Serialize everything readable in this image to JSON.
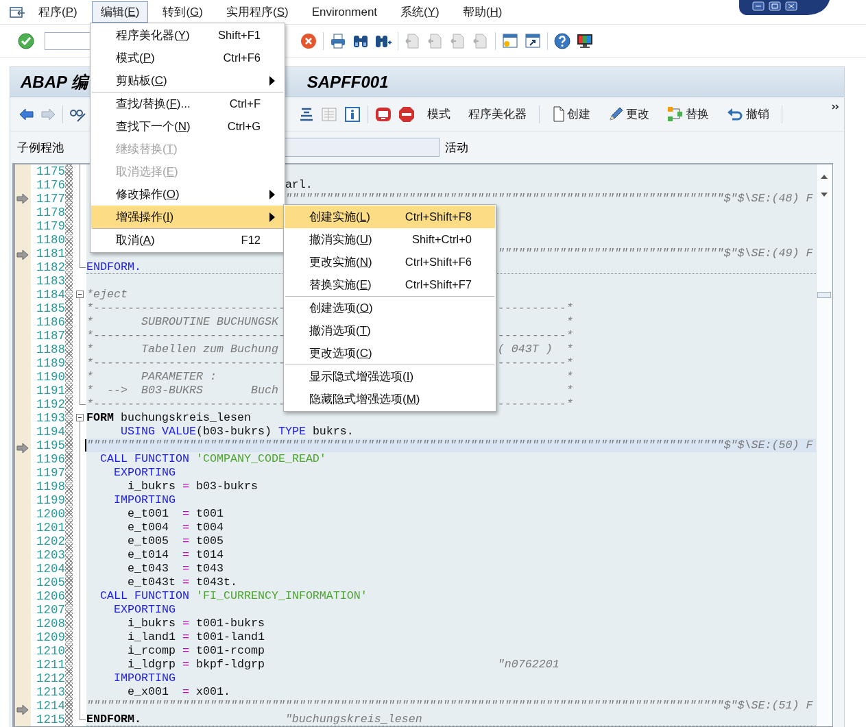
{
  "menubar": {
    "items": [
      {
        "label": "程序(P)",
        "selected": false
      },
      {
        "label": "编辑(E)",
        "selected": true
      },
      {
        "label": "转到(G)",
        "selected": false
      },
      {
        "label": "实用程序(S)",
        "selected": false
      },
      {
        "label": "Environment",
        "selected": false
      },
      {
        "label": "系统(Y)",
        "selected": false
      },
      {
        "label": "帮助(H)",
        "selected": false
      }
    ]
  },
  "title": {
    "left": "ABAP 编",
    "right": "SAPFF001"
  },
  "app_toolbar": {
    "buttons": [
      {
        "label": "模式"
      },
      {
        "label": "程序美化器"
      },
      {
        "label": "创建"
      },
      {
        "label": "更改"
      },
      {
        "label": "替换"
      },
      {
        "label": "撤销"
      }
    ]
  },
  "program_row": {
    "label": "子例程池",
    "status": "活动"
  },
  "editor": {
    "lines": [
      {
        "no": "1175",
        "kind": "fold-body",
        "marker": false,
        "current": false,
        "separator": false
      },
      {
        "no": "1176",
        "kind": "fold-body",
        "marker": false,
        "current": false,
        "separator": false,
        "segments": [
          {
            "kind": "text",
            "text": "                             arl."
          }
        ]
      },
      {
        "no": "1177",
        "kind": "fold-body",
        "marker": true,
        "current": false,
        "separator": false,
        "segments": [
          {
            "kind": "marker",
            "text": "                             \"\"\"\"\"\"\"\"\"\"\"\"\"\"\"\"\"\"\"\"\"\"\"\"\"\"\"\"\"\"\"\"\"\"\"\"\"\"\"\"\"\"\"\"\"\"\"\"\"\"\"\"\"\"\"\"\"\"\"\"\"\"\"\"$\"$\\SE:(48) F"
          }
        ]
      },
      {
        "no": "1178",
        "kind": "fold-body",
        "marker": false,
        "current": false,
        "separator": false
      },
      {
        "no": "1179",
        "kind": "fold-body",
        "marker": false,
        "current": false,
        "separator": false
      },
      {
        "no": "1180",
        "kind": "fold-body",
        "marker": false,
        "current": false,
        "separator": false
      },
      {
        "no": "1181",
        "kind": "fold-body",
        "marker": true,
        "current": false,
        "separator": false,
        "segments": [
          {
            "kind": "marker",
            "text": "                                                            \"\"\"\"\"\"\"\"\"\"\"\"\"\"\"\"\"\"\"\"\"\"\"\"\"\"\"\"\"\"\"\"\"$\"$\\SE:(49) F"
          }
        ]
      },
      {
        "no": "1182",
        "kind": "fold-end",
        "marker": false,
        "current": false,
        "separator": true,
        "segments": [
          {
            "kind": "keyword",
            "text": "ENDFORM."
          }
        ]
      },
      {
        "no": "1183",
        "kind": "plain",
        "marker": false,
        "current": false,
        "separator": false
      },
      {
        "no": "1184",
        "kind": "fold-start",
        "marker": false,
        "current": false,
        "separator": false,
        "segments": [
          {
            "kind": "comment",
            "text": "*eject"
          }
        ]
      },
      {
        "no": "1185",
        "kind": "fold-body",
        "marker": false,
        "current": false,
        "separator": false,
        "segments": [
          {
            "kind": "comment",
            "text": "*----------------------------"
          },
          {
            "kind": "comment",
            "text": "                               ----------*"
          }
        ]
      },
      {
        "no": "1186",
        "kind": "fold-body",
        "marker": false,
        "current": false,
        "separator": false,
        "segments": [
          {
            "kind": "comment",
            "text": "*       SUBROUTINE BUCHUNGSK"
          },
          {
            "kind": "comment",
            "text": "                                          *"
          }
        ]
      },
      {
        "no": "1187",
        "kind": "fold-body",
        "marker": false,
        "current": false,
        "separator": false,
        "segments": [
          {
            "kind": "comment",
            "text": "*----------------------------"
          },
          {
            "kind": "comment",
            "text": "                               ----------*"
          }
        ]
      },
      {
        "no": "1188",
        "kind": "fold-body",
        "marker": false,
        "current": false,
        "separator": false,
        "segments": [
          {
            "kind": "comment",
            "text": "*       Tabellen zum Buchung"
          },
          {
            "kind": "comment",
            "text": "                                ( 043T )  *"
          }
        ]
      },
      {
        "no": "1189",
        "kind": "fold-body",
        "marker": false,
        "current": false,
        "separator": false,
        "segments": [
          {
            "kind": "comment",
            "text": "*----------------------------"
          },
          {
            "kind": "comment",
            "text": "                               ----------*"
          }
        ]
      },
      {
        "no": "1190",
        "kind": "fold-body",
        "marker": false,
        "current": false,
        "separator": false,
        "segments": [
          {
            "kind": "comment",
            "text": "*       PARAMETER :"
          },
          {
            "kind": "comment",
            "text": "                                                   *"
          }
        ]
      },
      {
        "no": "1191",
        "kind": "fold-body",
        "marker": false,
        "current": false,
        "separator": false,
        "segments": [
          {
            "kind": "comment",
            "text": "*  -->  B03-BUKRS       Buch"
          },
          {
            "kind": "comment",
            "text": "                                          *"
          }
        ]
      },
      {
        "no": "1192",
        "kind": "fold-end",
        "marker": false,
        "current": false,
        "separator": false,
        "segments": [
          {
            "kind": "comment",
            "text": "*----------------------------"
          },
          {
            "kind": "comment",
            "text": "                               ----------*"
          }
        ]
      },
      {
        "no": "1193",
        "kind": "fold-start",
        "marker": false,
        "current": false,
        "separator": false,
        "segments": [
          {
            "kind": "bold",
            "text": "FORM"
          },
          {
            "kind": "text",
            "text": " buchungskreis_lesen"
          }
        ]
      },
      {
        "no": "1194",
        "kind": "fold-body",
        "marker": false,
        "current": false,
        "separator": false,
        "segments": [
          {
            "kind": "keyword",
            "text": "     USING VALUE"
          },
          {
            "kind": "text",
            "text": "(b03-bukrs) "
          },
          {
            "kind": "keyword",
            "text": "TYPE"
          },
          {
            "kind": "text",
            "text": " bukrs."
          }
        ]
      },
      {
        "no": "1195",
        "kind": "fold-body",
        "marker": true,
        "current": true,
        "separator": false,
        "segments": [
          {
            "kind": "marker",
            "text": "\"\"\"\"\"\"\"\"\"\"\"\"\"\"\"\"\"\"\"\"\"\"\"\"\"\"\"\"\"\"\"\"\"\"\"\"\"\"\"\"\"\"\"\"\"\"\"\"\"\"\"\"\"\"\"\"\"\"\"\"\"\"\"\"\"\"\"\"\"\"\"\"\"\"\"\"\"\"\"\"\"\"\"\"\"\"\"\"\"\"\"\"\"$\"$\\SE:(50) F"
          }
        ]
      },
      {
        "no": "1196",
        "kind": "fold-body",
        "marker": false,
        "current": false,
        "separator": false,
        "segments": [
          {
            "kind": "keyword",
            "text": "  CALL FUNCTION"
          },
          {
            "kind": "string",
            "text": " 'COMPANY_CODE_READ'"
          }
        ]
      },
      {
        "no": "1197",
        "kind": "fold-body",
        "marker": false,
        "current": false,
        "separator": false,
        "segments": [
          {
            "kind": "keyword",
            "text": "    EXPORTING"
          }
        ]
      },
      {
        "no": "1198",
        "kind": "fold-body",
        "marker": false,
        "current": false,
        "separator": false,
        "segments": [
          {
            "kind": "text",
            "text": "      i_bukrs "
          },
          {
            "kind": "operator",
            "text": "="
          },
          {
            "kind": "text",
            "text": " b03-bukrs"
          }
        ]
      },
      {
        "no": "1199",
        "kind": "fold-body",
        "marker": false,
        "current": false,
        "separator": false,
        "segments": [
          {
            "kind": "keyword",
            "text": "    IMPORTING"
          }
        ]
      },
      {
        "no": "1200",
        "kind": "fold-body",
        "marker": false,
        "current": false,
        "separator": false,
        "segments": [
          {
            "kind": "text",
            "text": "      e_t001  "
          },
          {
            "kind": "operator",
            "text": "="
          },
          {
            "kind": "text",
            "text": " t001"
          }
        ]
      },
      {
        "no": "1201",
        "kind": "fold-body",
        "marker": false,
        "current": false,
        "separator": false,
        "segments": [
          {
            "kind": "text",
            "text": "      e_t004  "
          },
          {
            "kind": "operator",
            "text": "="
          },
          {
            "kind": "text",
            "text": " t004"
          }
        ]
      },
      {
        "no": "1202",
        "kind": "fold-body",
        "marker": false,
        "current": false,
        "separator": false,
        "segments": [
          {
            "kind": "text",
            "text": "      e_t005  "
          },
          {
            "kind": "operator",
            "text": "="
          },
          {
            "kind": "text",
            "text": " t005"
          }
        ]
      },
      {
        "no": "1203",
        "kind": "fold-body",
        "marker": false,
        "current": false,
        "separator": false,
        "segments": [
          {
            "kind": "text",
            "text": "      e_t014  "
          },
          {
            "kind": "operator",
            "text": "="
          },
          {
            "kind": "text",
            "text": " t014"
          }
        ]
      },
      {
        "no": "1204",
        "kind": "fold-body",
        "marker": false,
        "current": false,
        "separator": false,
        "segments": [
          {
            "kind": "text",
            "text": "      e_t043  "
          },
          {
            "kind": "operator",
            "text": "="
          },
          {
            "kind": "text",
            "text": " t043"
          }
        ]
      },
      {
        "no": "1205",
        "kind": "fold-body",
        "marker": false,
        "current": false,
        "separator": false,
        "segments": [
          {
            "kind": "text",
            "text": "      e_t043t "
          },
          {
            "kind": "operator",
            "text": "="
          },
          {
            "kind": "text",
            "text": " t043t."
          }
        ]
      },
      {
        "no": "1206",
        "kind": "fold-body",
        "marker": false,
        "current": false,
        "separator": false,
        "segments": [
          {
            "kind": "keyword",
            "text": "  CALL FUNCTION"
          },
          {
            "kind": "string",
            "text": " 'FI_CURRENCY_INFORMATION'"
          }
        ]
      },
      {
        "no": "1207",
        "kind": "fold-body",
        "marker": false,
        "current": false,
        "separator": false,
        "segments": [
          {
            "kind": "keyword",
            "text": "    EXPORTING"
          }
        ]
      },
      {
        "no": "1208",
        "kind": "fold-body",
        "marker": false,
        "current": false,
        "separator": false,
        "segments": [
          {
            "kind": "text",
            "text": "      i_bukrs "
          },
          {
            "kind": "operator",
            "text": "="
          },
          {
            "kind": "text",
            "text": " t001-bukrs"
          }
        ]
      },
      {
        "no": "1209",
        "kind": "fold-body",
        "marker": false,
        "current": false,
        "separator": false,
        "segments": [
          {
            "kind": "text",
            "text": "      i_land1 "
          },
          {
            "kind": "operator",
            "text": "="
          },
          {
            "kind": "text",
            "text": " t001-land1"
          }
        ]
      },
      {
        "no": "1210",
        "kind": "fold-body",
        "marker": false,
        "current": false,
        "separator": false,
        "segments": [
          {
            "kind": "text",
            "text": "      i_rcomp "
          },
          {
            "kind": "operator",
            "text": "="
          },
          {
            "kind": "text",
            "text": " t001-rcomp"
          }
        ]
      },
      {
        "no": "1211",
        "kind": "fold-body",
        "marker": false,
        "current": false,
        "separator": false,
        "segments": [
          {
            "kind": "text",
            "text": "      i_ldgrp "
          },
          {
            "kind": "operator",
            "text": "="
          },
          {
            "kind": "text",
            "text": " bkpf-ldgrp"
          },
          {
            "kind": "comment",
            "text": "                                  \"n0762201"
          }
        ]
      },
      {
        "no": "1212",
        "kind": "fold-body",
        "marker": false,
        "current": false,
        "separator": false,
        "segments": [
          {
            "kind": "keyword",
            "text": "    IMPORTING"
          }
        ]
      },
      {
        "no": "1213",
        "kind": "fold-body",
        "marker": false,
        "current": false,
        "separator": false,
        "segments": [
          {
            "kind": "text",
            "text": "      e_x001  "
          },
          {
            "kind": "operator",
            "text": "="
          },
          {
            "kind": "text",
            "text": " x001."
          }
        ]
      },
      {
        "no": "1214",
        "kind": "fold-body",
        "marker": true,
        "current": false,
        "separator": false,
        "segments": [
          {
            "kind": "marker",
            "text": "\"\"\"\"\"\"\"\"\"\"\"\"\"\"\"\"\"\"\"\"\"\"\"\"\"\"\"\"\"\"\"\"\"\"\"\"\"\"\"\"\"\"\"\"\"\"\"\"\"\"\"\"\"\"\"\"\"\"\"\"\"\"\"\"\"\"\"\"\"\"\"\"\"\"\"\"\"\"\"\"\"\"\"\"\"\"\"\"\"\"\"\"\"$\"$\\SE:(51) F"
          }
        ]
      },
      {
        "no": "1215",
        "kind": "fold-end",
        "marker": false,
        "current": false,
        "separator": true,
        "segments": [
          {
            "kind": "bold",
            "text": "ENDFORM."
          },
          {
            "kind": "comment",
            "text": "                     \"buchungskreis_lesen"
          }
        ]
      }
    ]
  },
  "menus": [
    {
      "kind": "dropdown",
      "groups": [
        [
          {
            "kind": "command",
            "label": "程序美化器(Y)",
            "shortcut": "Shift+F1",
            "disabled": false,
            "selected": false
          },
          {
            "kind": "command",
            "label": "模式(P)",
            "shortcut": "Ctrl+F6",
            "disabled": false,
            "selected": false
          },
          {
            "kind": "submenu",
            "label": "剪贴板(C)",
            "disabled": false,
            "selected": false
          }
        ],
        [
          {
            "kind": "command",
            "label": "查找/替换(F)...",
            "shortcut": "Ctrl+F",
            "disabled": false,
            "selected": false
          },
          {
            "kind": "command",
            "label": "查找下一个(N)",
            "shortcut": "Ctrl+G",
            "disabled": false,
            "selected": false
          },
          {
            "kind": "command",
            "label": "继续替换(T)",
            "disabled": true,
            "selected": false
          },
          {
            "kind": "command",
            "label": "取消选择(E)",
            "disabled": true,
            "selected": false
          },
          {
            "kind": "submenu",
            "label": "修改操作(O)",
            "disabled": false,
            "selected": false
          },
          {
            "kind": "submenu",
            "label": "增强操作(I)",
            "disabled": false,
            "selected": true
          }
        ],
        [
          {
            "kind": "command",
            "label": "取消(A)",
            "shortcut": "F12",
            "disabled": false,
            "selected": false
          }
        ]
      ]
    },
    {
      "kind": "submenu",
      "groups": [
        [
          {
            "kind": "command",
            "label": "创建实施(L)",
            "shortcut": "Ctrl+Shift+F8",
            "disabled": false,
            "selected": true
          },
          {
            "kind": "command",
            "label": "撤消实施(U)",
            "shortcut": "Shift+Ctrl+0",
            "disabled": false,
            "selected": false
          },
          {
            "kind": "command",
            "label": "更改实施(N)",
            "shortcut": "Ctrl+Shift+F6",
            "disabled": false,
            "selected": false
          },
          {
            "kind": "command",
            "label": "替换实施(E)",
            "shortcut": "Ctrl+Shift+F7",
            "disabled": false,
            "selected": false
          }
        ],
        [
          {
            "kind": "command",
            "label": "创建选项(O)",
            "disabled": false,
            "selected": false
          },
          {
            "kind": "command",
            "label": "撤消选项(T)",
            "disabled": false,
            "selected": false
          },
          {
            "kind": "command",
            "label": "更改选项(C)",
            "disabled": false,
            "selected": false
          }
        ],
        [
          {
            "kind": "command",
            "label": "显示隐式增强选项(I)",
            "disabled": false,
            "selected": false
          },
          {
            "kind": "command",
            "label": "隐藏隐式增强选项(M)",
            "disabled": false,
            "selected": false
          }
        ]
      ]
    }
  ]
}
